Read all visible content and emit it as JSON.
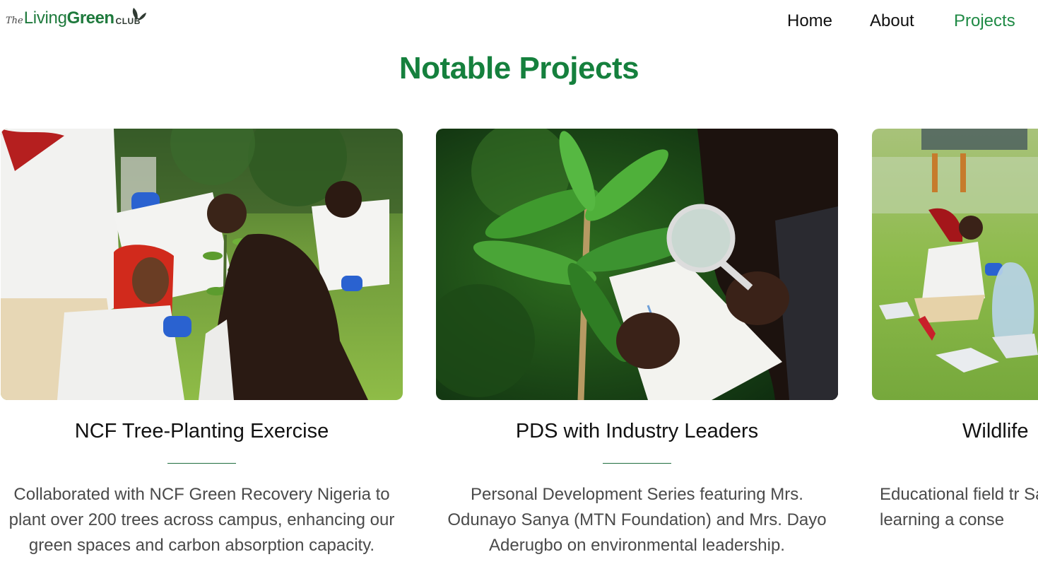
{
  "brand": {
    "the": "The",
    "living": "Living",
    "green": "Green",
    "club": "CLUB"
  },
  "nav": {
    "home": "Home",
    "about": "About",
    "projects": "Projects",
    "active": "Projects"
  },
  "section": {
    "title": "Notable Projects"
  },
  "projects": [
    {
      "title": "NCF Tree-Planting Exercise",
      "description": "Collaborated with NCF Green Recovery Nigeria to plant over 200 trees across campus, enhancing our green spaces and carbon absorption capacity."
    },
    {
      "title": "PDS with Industry Leaders",
      "description": "Personal Development Series featuring Mrs. Odunayo Sanya (MTN Foundation) and Mrs. Dayo Aderugbo on environmental leadership."
    },
    {
      "title": "Wildlife",
      "description": "Educational field tr Sanctuary, learning a conse"
    }
  ],
  "colors": {
    "brand_green": "#15803d",
    "nav_active": "#1f8a45",
    "divider": "#1f6e3f",
    "body_text": "#4a4a4a"
  }
}
